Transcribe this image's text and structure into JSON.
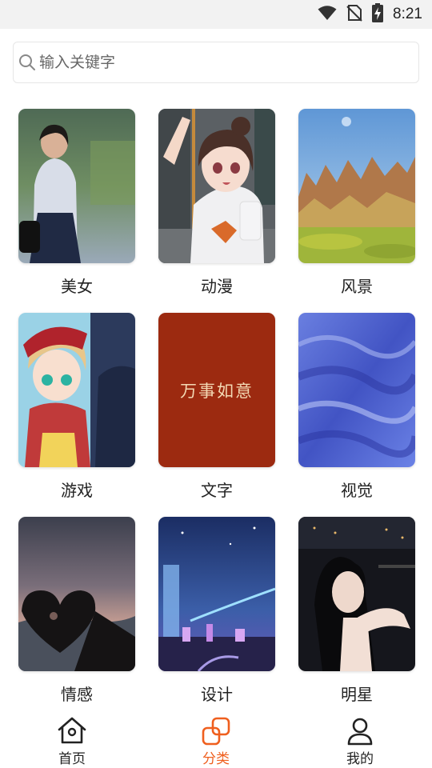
{
  "status_bar": {
    "time": "8:21",
    "icons": [
      "wifi-icon",
      "no-sim-icon",
      "battery-charging-icon"
    ]
  },
  "search": {
    "placeholder": "输入关键字",
    "value": ""
  },
  "categories": [
    {
      "label": "美女",
      "image": "girl-portrait"
    },
    {
      "label": "动漫",
      "image": "anime-girl"
    },
    {
      "label": "风景",
      "image": "landscape"
    },
    {
      "label": "游戏",
      "image": "game-characters"
    },
    {
      "label": "文字",
      "text_on_image": "万事如意"
    },
    {
      "label": "视觉",
      "image": "blue-abstract"
    },
    {
      "label": "情感",
      "image": "heart-hands"
    },
    {
      "label": "设计",
      "image": "night-city"
    },
    {
      "label": "明星",
      "image": "star-portrait"
    }
  ],
  "bottom_nav": {
    "items": [
      {
        "label": "首页",
        "icon": "home-icon"
      },
      {
        "label": "分类",
        "icon": "category-icon"
      },
      {
        "label": "我的",
        "icon": "profile-icon"
      }
    ],
    "active_index": 1
  },
  "colors": {
    "accent": "#ef5f1e",
    "text": "#222222",
    "status_bar_bg": "#f2f2f2"
  }
}
